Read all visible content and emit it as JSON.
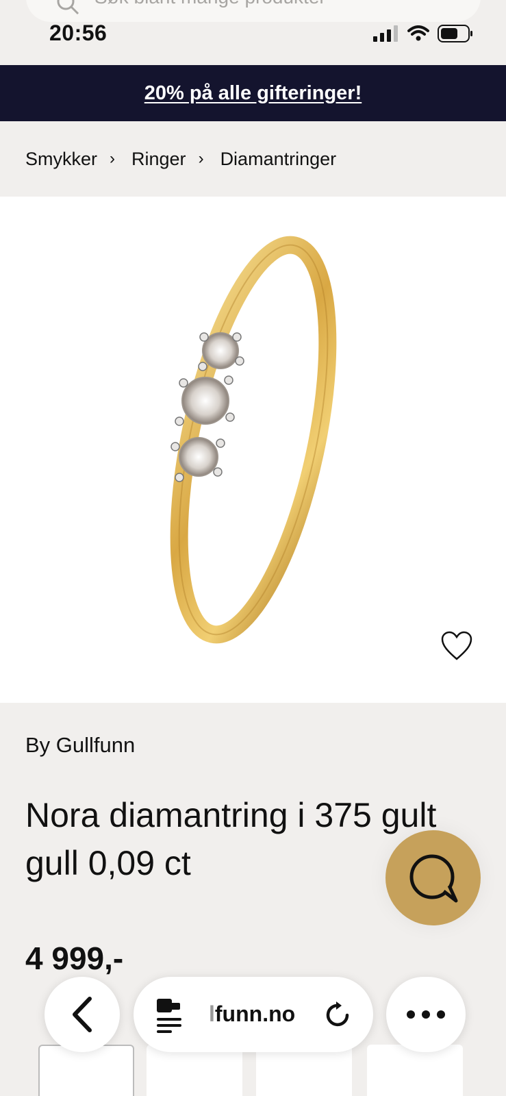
{
  "search": {
    "placeholder": "Søk blant mange produkter"
  },
  "status_bar": {
    "time": "20:56"
  },
  "promo": {
    "text": "20% på alle gifteringer!"
  },
  "breadcrumb": {
    "items": [
      "Smykker",
      "Ringer",
      "Diamantringer"
    ],
    "separator": "›"
  },
  "product": {
    "brand": "By Gullfunn",
    "title": "Nora diamantring i 375 gult gull 0,09 ct",
    "price": "4 999,-"
  },
  "browser": {
    "url_prefix": "l",
    "url": "funn.no"
  },
  "colors": {
    "promo_bg": "#14142e",
    "chat_button": "#c6a15b",
    "page_bg": "#f1efed"
  },
  "icons": {
    "search": "search-icon",
    "heart": "heart-icon",
    "chat": "chat-icon",
    "back": "back-icon",
    "reload": "reload-icon",
    "more": "more-icon",
    "reader": "reader-icon"
  }
}
